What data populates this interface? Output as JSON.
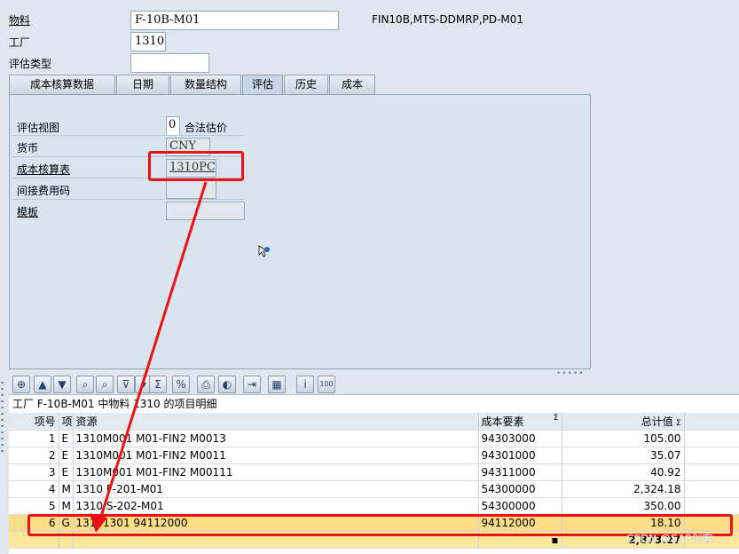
{
  "header": {
    "material_label": "物料",
    "material_value": "F-10B-M01",
    "material_desc": "FIN10B,MTS-DDMRP,PD-M01",
    "plant_label": "工厂",
    "plant_value": "1310",
    "valuation_type_label": "评估类型",
    "valuation_type_value": ""
  },
  "tabs": [
    {
      "label": "成本核算数据"
    },
    {
      "label": "日期"
    },
    {
      "label": "数量结构"
    },
    {
      "label": "评估"
    },
    {
      "label": "历史"
    },
    {
      "label": "成本"
    }
  ],
  "active_tab": "评估",
  "valuation": {
    "view_label": "评估视图",
    "view_value": "0",
    "view_text": "合法估价",
    "currency_label": "货币",
    "currency_value": "CNY",
    "costing_sheet_label": "成本核算表",
    "costing_sheet_value": "1310PC",
    "overhead_key_label": "间接费用码",
    "overhead_key_value": "",
    "template_label": "模板",
    "template_value": ""
  },
  "alv": {
    "title": "工厂 F-10B-M01 中物料 1310 的项目明细",
    "columns": [
      "项号",
      "项",
      "资源",
      "成本要素",
      "总计值"
    ],
    "rows": [
      {
        "item": "1",
        "type": "E",
        "resource": "1310M001   M01-FIN2 M0013",
        "cost_element": "94303000",
        "total": "105.00"
      },
      {
        "item": "2",
        "type": "E",
        "resource": "1310M001   M01-FIN2 M0011",
        "cost_element": "94301000",
        "total": "35.07"
      },
      {
        "item": "3",
        "type": "E",
        "resource": "1310M001   M01-FIN2 M00111",
        "cost_element": "94311000",
        "total": "40.92"
      },
      {
        "item": "4",
        "type": "M",
        "resource": "1310 F-201-M01",
        "cost_element": "54300000",
        "total": "2,324.18"
      },
      {
        "item": "5",
        "type": "M",
        "resource": "1310 S-202-M01",
        "cost_element": "54300000",
        "total": "350.00"
      },
      {
        "item": "6",
        "type": "G",
        "resource": "13101301 94112000",
        "cost_element": "94112000",
        "total": "18.10"
      }
    ],
    "grand_total": "2,873.27",
    "sum_marker": "▪"
  },
  "watermark": "CSDN @SAP剑客",
  "colors": {
    "highlight_red": "#e11111",
    "selected_row": "#fbdc87",
    "total_row": "#fae79c"
  }
}
